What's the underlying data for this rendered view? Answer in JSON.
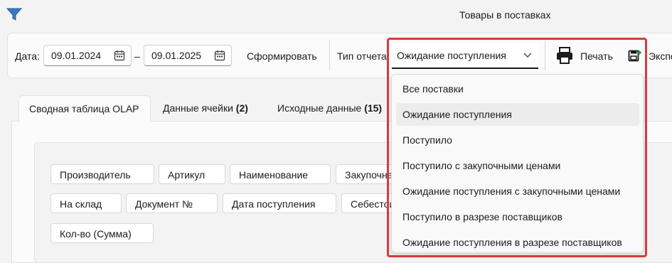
{
  "window": {
    "title": "Товары в поставках",
    "filter_icon": "filter-icon"
  },
  "toolbar": {
    "date_label": "Дата:",
    "date_from": "09.01.2024",
    "date_sep": "–",
    "date_to": "09.01.2025",
    "form_button": "Сформировать",
    "report_type_label": "Тип отчета",
    "report_type_value": "Ожидание поступления",
    "print_button": "Печать",
    "export_button": "Экспо"
  },
  "tabs": [
    {
      "label": "Сводная таблица OLAP",
      "count": ""
    },
    {
      "label": "Данные ячейки",
      "count": "(2)"
    },
    {
      "label": "Исходные данные",
      "count": "(15)"
    }
  ],
  "olap_fields": {
    "row1": [
      "Производитель",
      "Артикул",
      "Наименование",
      "Закупочная"
    ],
    "row2": [
      "На склад",
      "Документ №",
      "Дата поступления",
      "Себестоимость"
    ],
    "row3": [
      "Кол-во (Сумма)"
    ]
  },
  "dropdown": {
    "items": [
      "Все поставки",
      "Ожидание поступления",
      "Поступило",
      "Поступило с закупочными ценами",
      "Ожидание поступления с закупочными ценами",
      "Поступило в разрезе поставщиков",
      "Ожидание поступления в разрезе поставщиков"
    ],
    "selected_index": 1,
    "highlight_color": "#d83a3a"
  }
}
